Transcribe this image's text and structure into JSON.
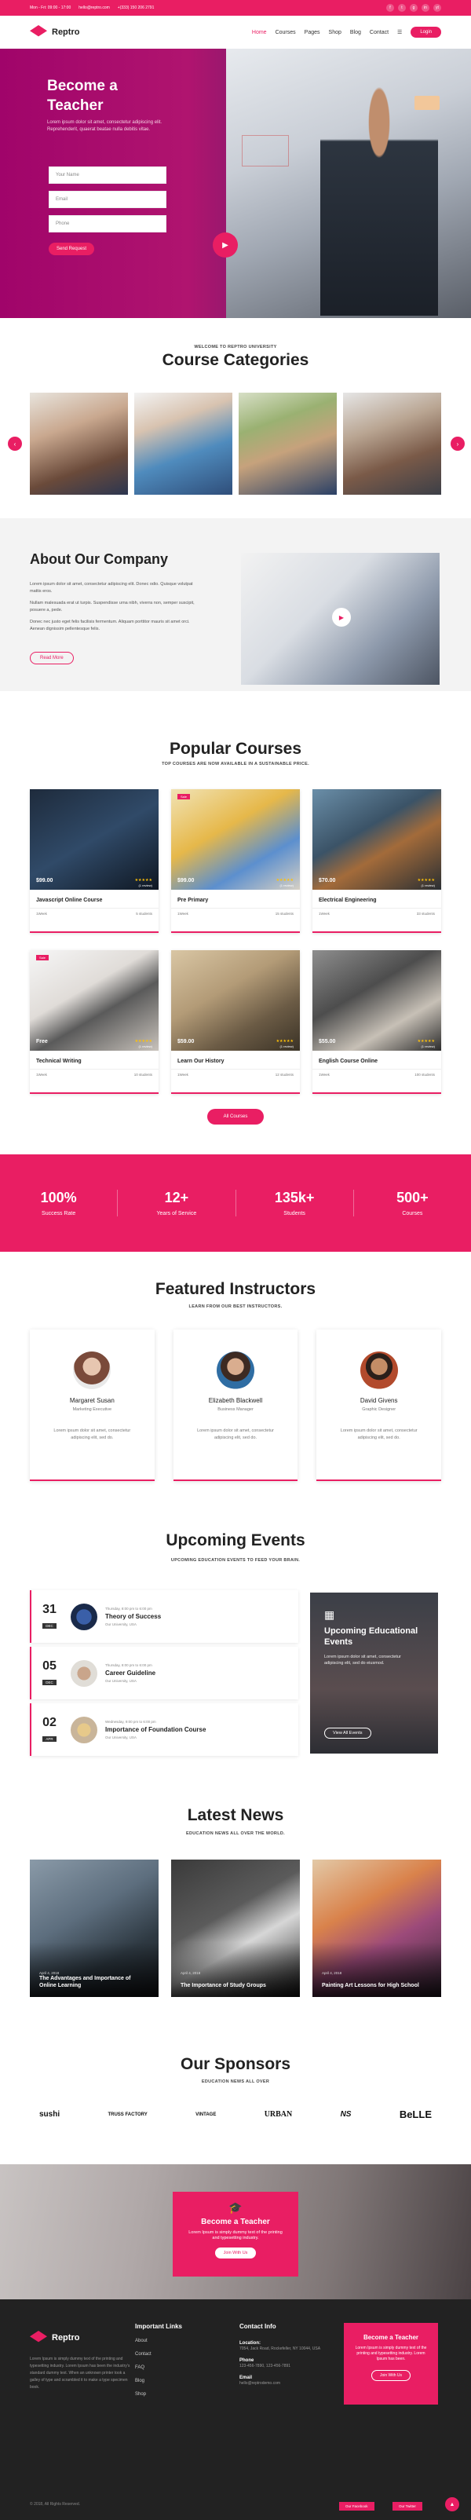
{
  "topbar": {
    "hours": "Mon - Fri: 09:00 - 17:00",
    "email": "hello@reptro.com",
    "phone": "+(333) 150 206 2791",
    "socials": [
      "f",
      "t",
      "g",
      "in",
      "yt"
    ]
  },
  "nav": {
    "brand": "Reptro",
    "items": [
      "Home",
      "Courses",
      "Pages",
      "Shop",
      "Blog",
      "Contact"
    ],
    "login": "Login"
  },
  "hero": {
    "title_line1": "Become a",
    "title_line2": "Teacher",
    "desc": "Lorem ipsum dolor sit amet, consectetur adipiscing elit. Reprehenderit, quaerat beatae nulla debitis vitae.",
    "fields": [
      "Your Name",
      "Email",
      "Phone"
    ],
    "submit": "Send Request"
  },
  "categories": {
    "eyebrow": "WELCOME TO REPTRO UNIVERSITY",
    "title": "Course Categories"
  },
  "about": {
    "title": "About Our Company",
    "paragraphs": [
      "Lorem ipsum dolor sit amet, consectetur adipiscing elit. Donec odio. Quisque volutpat mattis eros.",
      "Nullam malesuada erat ut turpis. Suspendisse urna nibh, viverra non, semper suscipit, posuere a, pede.",
      "Donec nec justo eget felis facilisis fermentum. Aliquam porttitor mauris sit amet orci. Aenean dignissim pellentesque felis."
    ],
    "button": "Read More"
  },
  "courses": {
    "title": "Popular Courses",
    "subtitle": "TOP COURSES ARE NOW AVAILABLE IN A SUSTAINABLE PRICE.",
    "items": [
      {
        "name": "Javascript Online Course",
        "price": "$99.00",
        "reviews": "(1 review)",
        "duration": "1Week",
        "students": "5 students",
        "sale": ""
      },
      {
        "name": "Pre Primary",
        "price": "$99.00",
        "reviews": "(1 review)",
        "duration": "1Week",
        "students": "15 students",
        "sale": "Sale"
      },
      {
        "name": "Electrical Engineering",
        "price": "$70.00",
        "reviews": "(1 review)",
        "duration": "1Week",
        "students": "33 students",
        "sale": ""
      },
      {
        "name": "Technical Writing",
        "price": "Free",
        "reviews": "(1 review)",
        "duration": "1Week",
        "students": "10 students",
        "sale": "Sale"
      },
      {
        "name": "Learn Our History",
        "price": "$59.00",
        "reviews": "(1 review)",
        "duration": "1Week",
        "students": "12 students",
        "sale": ""
      },
      {
        "name": "English Course Online",
        "price": "$55.00",
        "reviews": "(1 review)",
        "duration": "1Week",
        "students": "100 students",
        "sale": ""
      }
    ],
    "all_button": "All Courses"
  },
  "stats": [
    {
      "num": "100%",
      "label": "Success Rate"
    },
    {
      "num": "12+",
      "label": "Years of Service"
    },
    {
      "num": "135k+",
      "label": "Students"
    },
    {
      "num": "500+",
      "label": "Courses"
    }
  ],
  "instructors": {
    "title": "Featured Instructors",
    "subtitle": "LEARN FROM OUR BEST INSTRUCTORS.",
    "items": [
      {
        "name": "Margaret Susan",
        "role": "Marketing Executive",
        "bio": "Lorem ipsum dolor sit amet, consectetur adipiscing elit, sed do."
      },
      {
        "name": "Elizabeth Blackwell",
        "role": "Business Manager",
        "bio": "Lorem ipsum dolor sit amet, consectetur adipiscing elit, sed do."
      },
      {
        "name": "David Givens",
        "role": "Graphic Designer",
        "bio": "Lorem ipsum dolor sit amet, consectetur adipiscing elit, sed do."
      }
    ]
  },
  "events": {
    "title": "Upcoming Events",
    "subtitle": "UPCOMING EDUCATION EVENTS TO FEED YOUR BRAIN.",
    "items": [
      {
        "day": "31",
        "month": "DEC",
        "time": "Thursday, 8:00 pm to 6:00 pm",
        "title": "Theory of Success",
        "place": "Our University, USA"
      },
      {
        "day": "05",
        "month": "DEC",
        "time": "Thursday, 8:00 pm to 6:00 pm",
        "title": "Career Guideline",
        "place": "Our University, USA"
      },
      {
        "day": "02",
        "month": "APR",
        "time": "Wednesday, 9:00 pm to 6:00 pm",
        "title": "Importance of Foundation Course",
        "place": "Our University, USA"
      }
    ],
    "promo": {
      "title": "Upcoming Educational Events",
      "text": "Lorem ipsum dolor sit amet, consectetur adipiscing elit, sed do eiusmod.",
      "button": "View All Events"
    }
  },
  "news": {
    "title": "Latest News",
    "subtitle": "EDUCATION NEWS ALL OVER THE WORLD.",
    "items": [
      {
        "date": "April 4, 2018",
        "headline": "The Advantages and Importance of Online Learning"
      },
      {
        "date": "April 4, 2018",
        "headline": "The Importance of Study Groups"
      },
      {
        "date": "April 4, 2018",
        "headline": "Painting Art Lessons for High School"
      }
    ]
  },
  "sponsors": {
    "title": "Our Sponsors",
    "subtitle": "EDUCATION NEWS ALL OVER",
    "items": [
      "sushi",
      "TRUSS FACTORY",
      "VINTAGE",
      "URBAN",
      "NS",
      "BeLLE"
    ]
  },
  "cta": {
    "title": "Become a Teacher",
    "text": "Lorem Ipsum is simply dummy text of the printing and typesetting industry.",
    "button": "Join With Us"
  },
  "footer": {
    "brand": "Reptro",
    "about": "Lorem Ipsum is simply dummy text of the printing and typesetting industry. Lorem Ipsum has been the industry's standard dummy text. When an unknown printer took a galley of type and scrambled it to make a type specimen book.",
    "links_title": "Important Links",
    "links": [
      "About",
      "Contact",
      "FAQ",
      "Blog",
      "Shop"
    ],
    "contact_title": "Contact Info",
    "location_label": "Location:",
    "location": "7054, Jack Road, Rockefeller, NY 10044, USA",
    "phone_label": "Phone",
    "phone": "123-456-7890, 123-456-7891",
    "email_label": "Email",
    "email": "hello@reptrodemo.com",
    "box_title": "Become a Teacher",
    "box_text": "Lorem Ipsum is simply dummy text of the printing and typesetting industry. Lorem Ipsum has been.",
    "box_button": "Join With Us",
    "copyright": "© 2018, All Rights Reserved.",
    "share_fb": "Our Facebook",
    "share_tw": "Our Twitter"
  }
}
